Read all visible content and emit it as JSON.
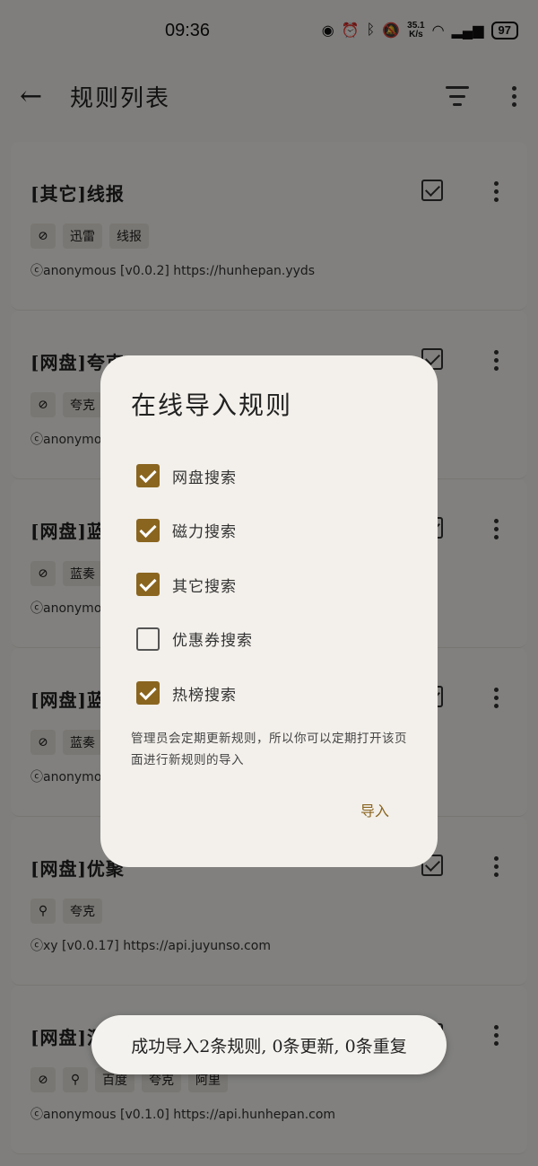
{
  "status": {
    "time": "09:36",
    "speed_value": "35.1",
    "speed_unit": "K/s",
    "battery": "97"
  },
  "appbar": {
    "title": "规则列表"
  },
  "cards": [
    {
      "name": "[其它]线报",
      "tags": [
        "迅雷",
        "线报"
      ],
      "icons": [
        "compass-icon"
      ],
      "meta": "ⓒanonymous [v0.0.2] https://hunhepan.yyds"
    },
    {
      "name": "[网盘]夸克",
      "tags": [
        "夸克"
      ],
      "icons": [
        "compass-icon"
      ],
      "meta": "ⓒanonymo"
    },
    {
      "name": "[网盘]蓝",
      "tags": [
        "蓝奏"
      ],
      "icons": [
        "compass-icon"
      ],
      "meta": "ⓒanonymo"
    },
    {
      "name": "[网盘]蓝",
      "tags": [
        "蓝奏"
      ],
      "icons": [
        "compass-icon"
      ],
      "meta": "ⓒanonymo"
    },
    {
      "name": "[网盘]优聚",
      "tags": [
        "夸克"
      ],
      "icons": [
        "search-icon"
      ],
      "meta": "ⓒxy [v0.0.17] https://api.juyunso.com"
    },
    {
      "name": "[网盘]混",
      "tags": [
        "百度",
        "夸克",
        "阿里"
      ],
      "icons": [
        "compass-icon",
        "search-icon"
      ],
      "meta": "ⓒanonymous [v0.1.0] https://api.hunhepan.com"
    }
  ],
  "dialog": {
    "title": "在线导入规则",
    "options": [
      {
        "label": "网盘搜索",
        "checked": true
      },
      {
        "label": "磁力搜索",
        "checked": true
      },
      {
        "label": "其它搜索",
        "checked": true
      },
      {
        "label": "优惠券搜索",
        "checked": false
      },
      {
        "label": "热榜搜索",
        "checked": true
      }
    ],
    "note": "管理员会定期更新规则，所以你可以定期打开该页面进行新规则的导入",
    "import_label": "导入"
  },
  "toast": {
    "message": "成功导入2条规则, 0条更新, 0条重复"
  },
  "colors": {
    "accent": "#8a6520",
    "scrim": "rgba(0,0,0,0.48)"
  }
}
